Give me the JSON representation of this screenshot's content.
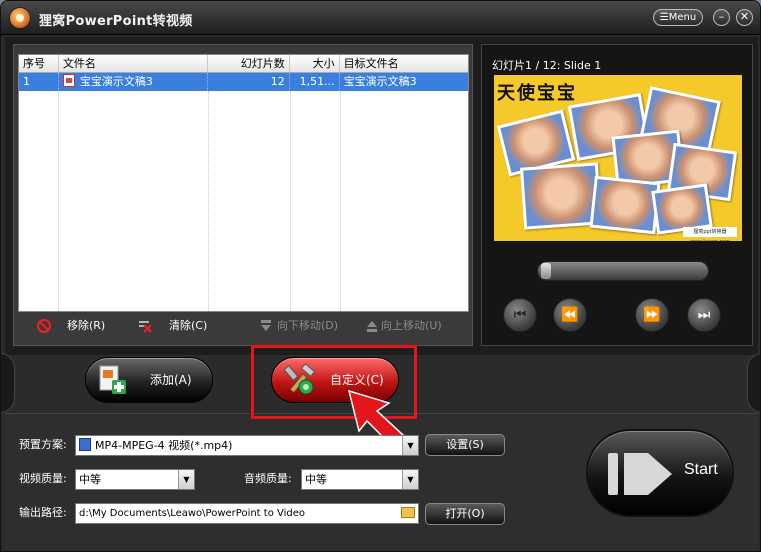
{
  "window": {
    "title": "狸窝PowerPoint转视频",
    "menu_label": "Menu",
    "minimize_glyph": "–",
    "close_glyph": "✕"
  },
  "file_list": {
    "columns": [
      "序号",
      "文件名",
      "幻灯片数",
      "大小",
      "目标文件名"
    ],
    "rows": [
      {
        "index": "1",
        "name": "宝宝演示文稿3",
        "slides": "12",
        "size": "1,51...",
        "target": "宝宝演示文稿3"
      }
    ]
  },
  "list_actions": {
    "remove": "移除(R)",
    "clear": "清除(C)",
    "move_down": "向下移动(D)",
    "move_up": "向上移动(U)"
  },
  "preview": {
    "caption": "幻灯片1 / 12: Slide 1",
    "slide_title": "天使宝宝",
    "footer_text": "狸窝ppt转换器 www.leawo.com"
  },
  "player": {
    "prev_icon": "skip-back-icon",
    "rewind_icon": "rewind-icon",
    "forward_icon": "fast-forward-icon",
    "next_icon": "skip-forward-icon"
  },
  "buttons": {
    "add": "添加(A)",
    "customize": "自定义(C)",
    "start": "Start"
  },
  "form": {
    "preset_label": "预置方案:",
    "preset_value": "MP4-MPEG-4 视频(*.mp4)",
    "settings_button": "设置(S)",
    "video_quality_label": "视频质量:",
    "video_quality_value": "中等",
    "audio_quality_label": "音频质量:",
    "audio_quality_value": "中等",
    "output_label": "输出路径:",
    "output_value": "d:\\My Documents\\Leawo\\PowerPoint to Video",
    "open_button": "打开(O)"
  },
  "colors": {
    "accent_red": "#e4151b",
    "selection_blue": "#3a7fe0",
    "slide_yellow": "#f6c92a"
  }
}
